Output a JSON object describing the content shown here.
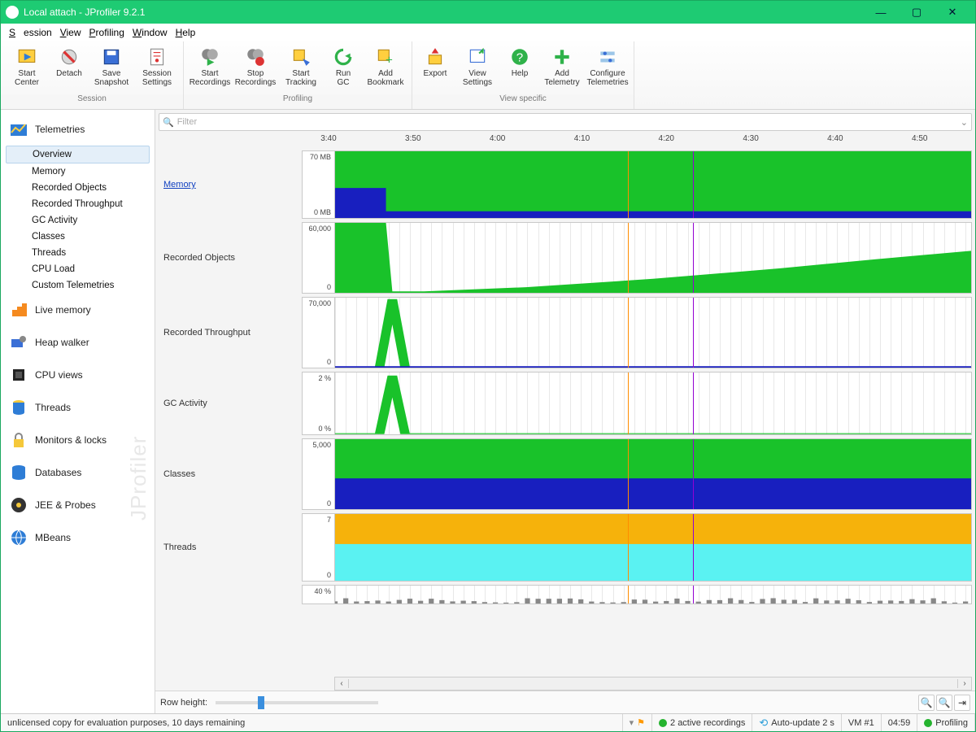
{
  "window": {
    "title": "Local attach - JProfiler 9.2.1"
  },
  "menu": [
    "Session",
    "View",
    "Profiling",
    "Window",
    "Help"
  ],
  "toolbar_groups": [
    {
      "label": "Session",
      "buttons": [
        {
          "id": "start-center",
          "label": "Start Center"
        },
        {
          "id": "detach",
          "label": "Detach"
        },
        {
          "id": "save-snapshot",
          "label": "Save Snapshot"
        },
        {
          "id": "session-settings",
          "label": "Session Settings"
        }
      ]
    },
    {
      "label": "Profiling",
      "buttons": [
        {
          "id": "start-rec",
          "label": "Start Recordings"
        },
        {
          "id": "stop-rec",
          "label": "Stop Recordings"
        },
        {
          "id": "start-track",
          "label": "Start Tracking"
        },
        {
          "id": "run-gc",
          "label": "Run GC"
        },
        {
          "id": "bookmark",
          "label": "Add Bookmark"
        }
      ]
    },
    {
      "label": "View specific",
      "buttons": [
        {
          "id": "export",
          "label": "Export"
        },
        {
          "id": "view-settings",
          "label": "View Settings"
        },
        {
          "id": "help",
          "label": "Help"
        },
        {
          "id": "add-tele",
          "label": "Add Telemetry"
        },
        {
          "id": "conf-tele",
          "label": "Configure Telemetries"
        }
      ]
    }
  ],
  "sidebar": {
    "sections": [
      {
        "id": "telemetries",
        "label": "Telemetries",
        "items": [
          "Overview",
          "Memory",
          "Recorded Objects",
          "Recorded Throughput",
          "GC Activity",
          "Classes",
          "Threads",
          "CPU Load",
          "Custom Telemetries"
        ],
        "active": 0,
        "expanded": true
      },
      {
        "id": "live-memory",
        "label": "Live memory"
      },
      {
        "id": "heap-walker",
        "label": "Heap walker"
      },
      {
        "id": "cpu-views",
        "label": "CPU views"
      },
      {
        "id": "threads",
        "label": "Threads"
      },
      {
        "id": "monitors",
        "label": "Monitors & locks"
      },
      {
        "id": "databases",
        "label": "Databases"
      },
      {
        "id": "jee",
        "label": "JEE & Probes"
      },
      {
        "id": "mbeans",
        "label": "MBeans"
      }
    ]
  },
  "filter_placeholder": "Filter",
  "timeline_ticks": [
    "3:40",
    "3:50",
    "4:00",
    "4:10",
    "4:20",
    "4:30",
    "4:40",
    "4:50"
  ],
  "marker_orange_pct": 46.0,
  "marker_purple_pct": 56.3,
  "row_height_label": "Row height:",
  "status": {
    "license": "unlicensed copy for evaluation purposes, 10 days remaining",
    "recordings": "2 active recordings",
    "auto_update": "Auto-update 2 s",
    "vm": "VM #1",
    "time": "04:59",
    "mode": "Profiling"
  },
  "chart_data": [
    {
      "name": "Memory",
      "type": "area",
      "ylabel_top": "70 MB",
      "ylabel_bot": "0 MB",
      "link": true,
      "series": [
        {
          "name": "heap_max",
          "color": "#19c22a",
          "fill": 100
        },
        {
          "name": "heap_used",
          "color": "#181fbf",
          "baseline": 10,
          "spike_to": 45,
          "spike_at_pct": 0,
          "spike_width_pct": 8
        }
      ]
    },
    {
      "name": "Recorded Objects",
      "type": "area",
      "ylabel_top": "60,000",
      "ylabel_bot": "0",
      "series": [
        {
          "name": "objects",
          "color": "#19c22a",
          "shape": "drop-then-rise",
          "drop_at_pct": 8,
          "rise_from_pct": 14,
          "rise_to_pct": 100,
          "start_h": 100,
          "min_h": 2,
          "end_h": 60
        }
      ]
    },
    {
      "name": "Recorded Throughput",
      "type": "line",
      "ylabel_top": "70,000",
      "ylabel_bot": "0",
      "series": [
        {
          "name": "throughput",
          "color": "#19c22a",
          "spike_at_pct": 9,
          "spike_h": 100,
          "baseline": 1
        }
      ]
    },
    {
      "name": "GC Activity",
      "type": "line",
      "ylabel_top": "2 %",
      "ylabel_bot": "0 %",
      "series": [
        {
          "name": "gc",
          "color": "#19c22a",
          "spike_at_pct": 9,
          "spike_h": 95,
          "baseline": 0
        }
      ]
    },
    {
      "name": "Classes",
      "type": "area",
      "ylabel_top": "5,000",
      "ylabel_bot": "0",
      "series": [
        {
          "name": "total",
          "color": "#19c22a",
          "fill": 100
        },
        {
          "name": "loaded",
          "color": "#181fbf",
          "fill": 44
        }
      ]
    },
    {
      "name": "Threads",
      "type": "area",
      "ylabel_top": "7",
      "ylabel_bot": "0",
      "series": [
        {
          "name": "runnable",
          "color": "#f6b20b",
          "fill": 100
        },
        {
          "name": "waiting",
          "color": "#5af2f2",
          "fill": 55
        }
      ]
    },
    {
      "name": "",
      "type": "bars",
      "ylabel_top": "40 %",
      "ylabel_bot": "",
      "series": [
        {
          "name": "cpu",
          "color": "#888",
          "bars": true
        }
      ]
    }
  ]
}
